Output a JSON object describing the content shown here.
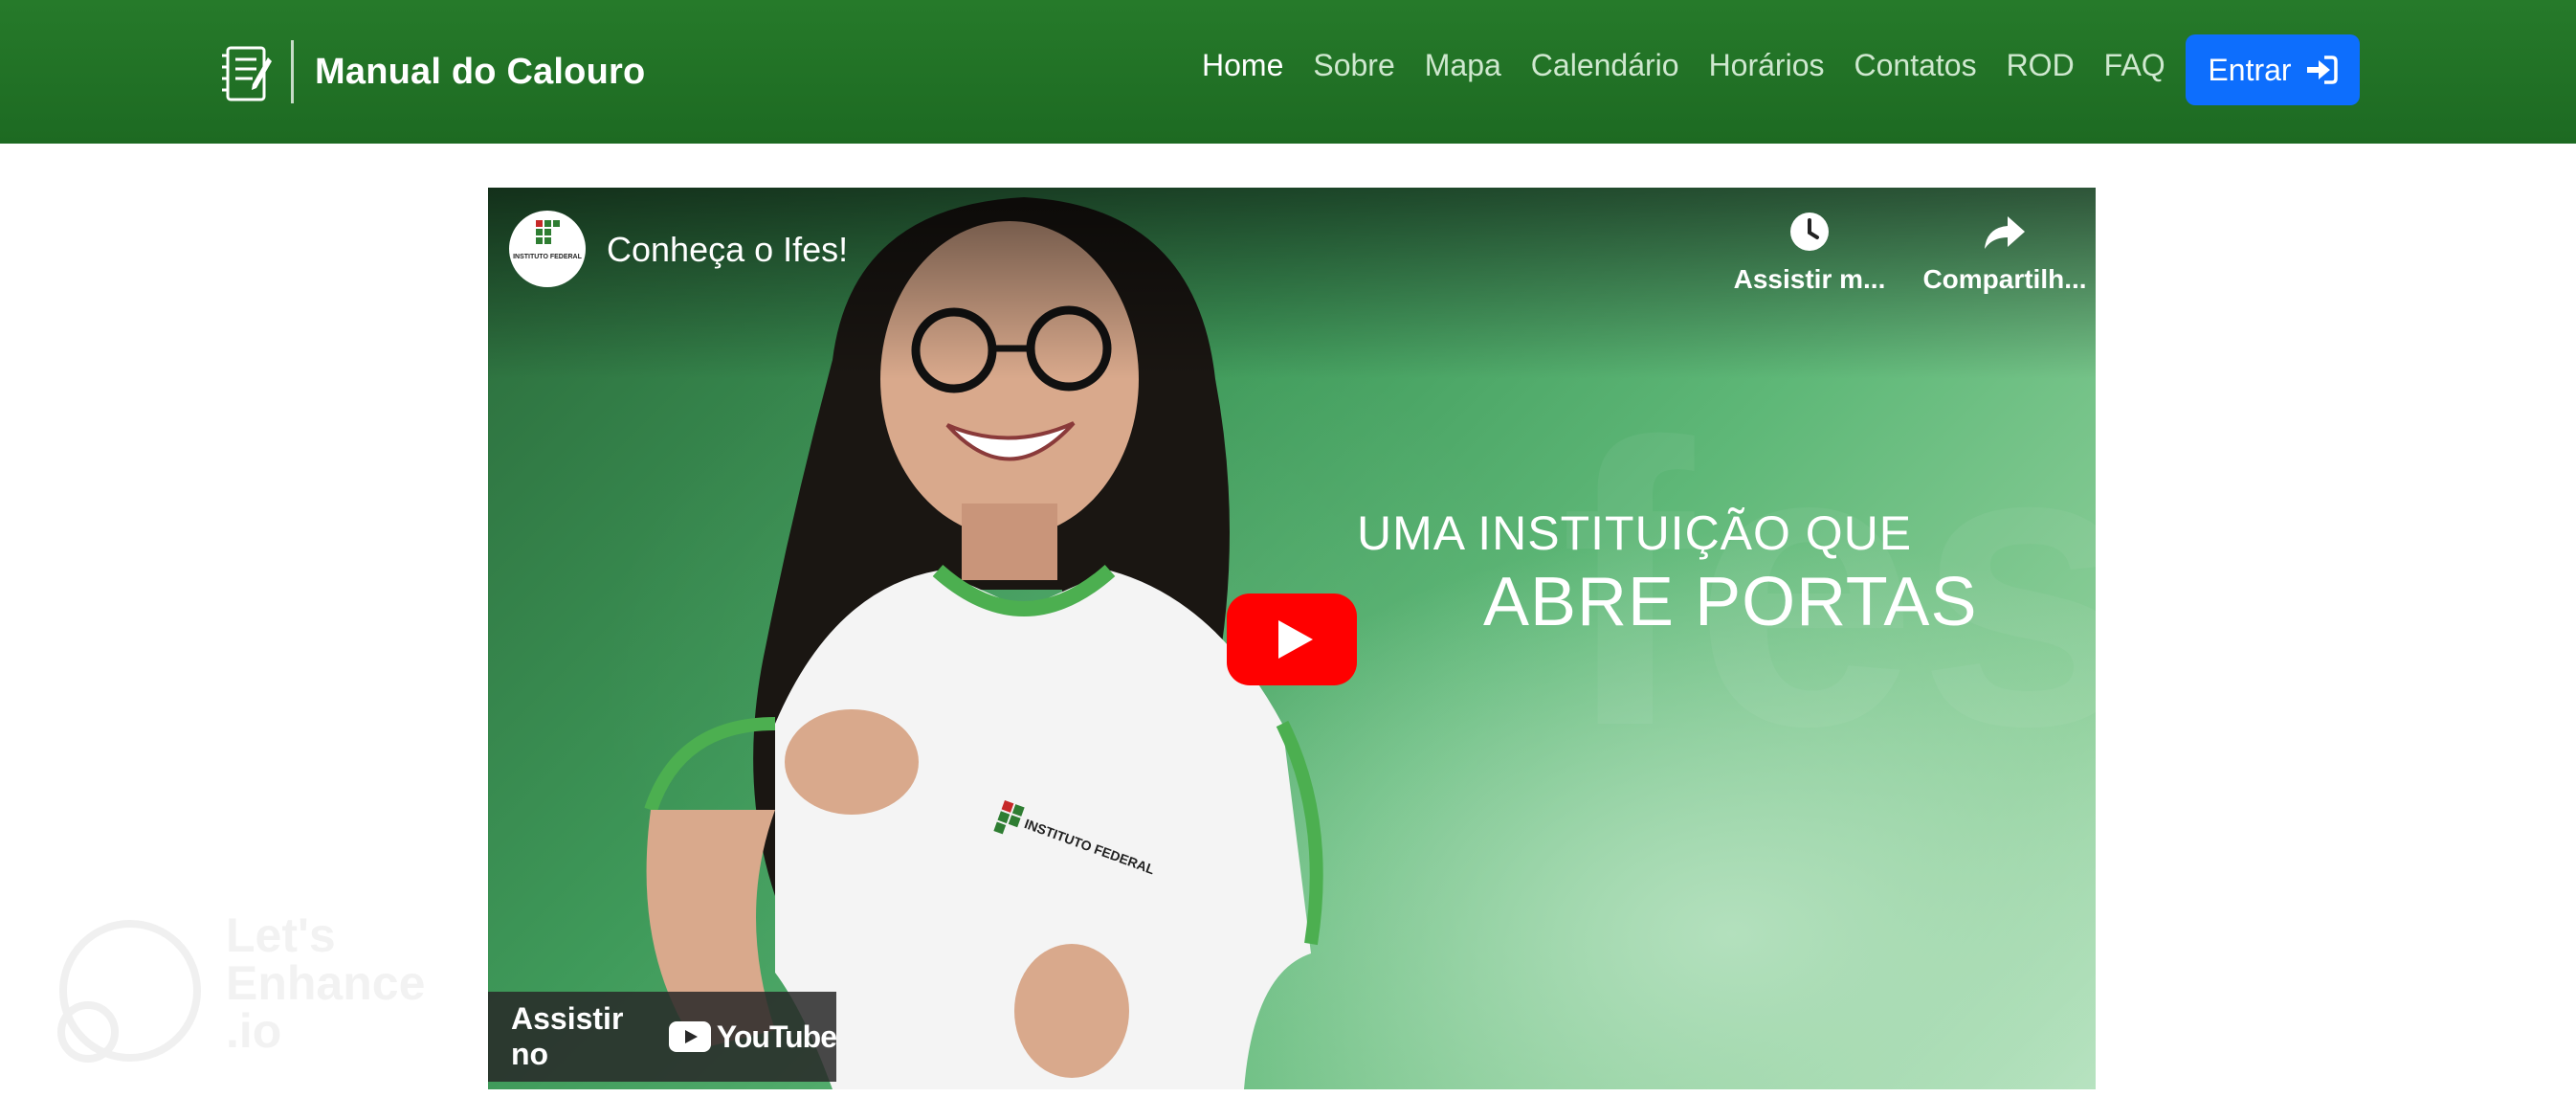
{
  "navbar": {
    "brand": {
      "title": "Manual do Calouro",
      "icon": "notebook-icon"
    },
    "links": [
      {
        "label": "Home",
        "active": true
      },
      {
        "label": "Sobre",
        "active": false
      },
      {
        "label": "Mapa",
        "active": false
      },
      {
        "label": "Calendário",
        "active": false
      },
      {
        "label": "Horários",
        "active": false
      },
      {
        "label": "Contatos",
        "active": false
      },
      {
        "label": "ROD",
        "active": false
      },
      {
        "label": "FAQ",
        "active": false
      }
    ],
    "login_button": {
      "label": "Entrar",
      "icon": "sign-in-icon"
    }
  },
  "video": {
    "title": "Conheça o Ifes!",
    "channel_logo": "ifes-logo",
    "channel_logo_text": "INSTITUTO FEDERAL",
    "actions": {
      "watch_later": "Assistir m...",
      "share": "Compartilh..."
    },
    "overlay": {
      "line1": "UMA INSTITUIÇÃO QUE",
      "line2": "ABRE PORTAS"
    },
    "shirt_logo_text": "INSTITUTO FEDERAL",
    "watch_on": "Assistir no",
    "youtube_wordmark": "YouTube"
  },
  "watermark": {
    "lines": [
      "Let's",
      "Enhance",
      ".io"
    ]
  },
  "colors": {
    "navbar": "#1f6f24",
    "nav_link": "#cfe8cf",
    "button_primary": "#0d6efd",
    "youtube_red": "#ff0000"
  }
}
